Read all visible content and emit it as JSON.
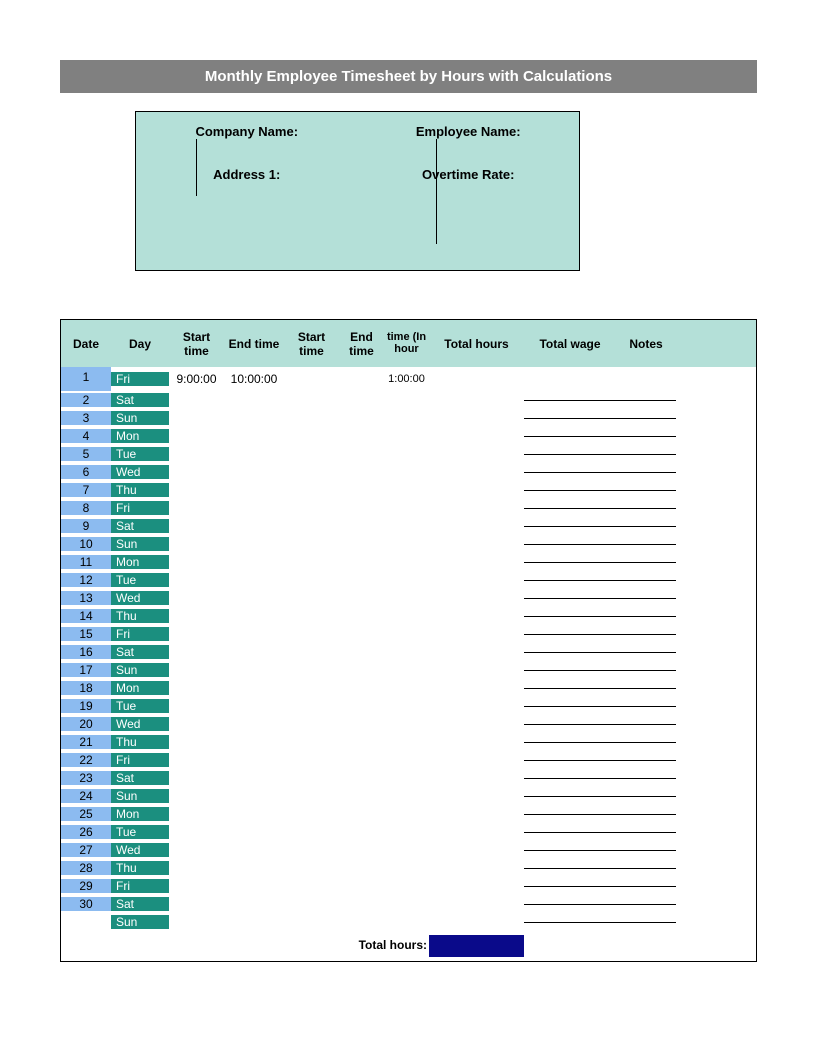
{
  "title": "Monthly Employee Timesheet by Hours with Calculations",
  "info": {
    "company_label": "Company Name:",
    "employee_label": "Employee Name:",
    "address_label": "Address 1:",
    "overtime_label": "Overtime Rate:"
  },
  "headers": {
    "date": "Date",
    "day": "Day",
    "start1": "Start time",
    "end1": "End time",
    "start2": "Start time",
    "end2": "End time",
    "tih": "time (In hour",
    "thours": "Total hours",
    "twage": "Total wage",
    "notes": "Notes"
  },
  "rows": [
    {
      "n": "1",
      "d": "Fri",
      "s": "9:00:00",
      "e": "10:00:00",
      "t": "1:00:00"
    },
    {
      "n": "2",
      "d": "Sat"
    },
    {
      "n": "3",
      "d": "Sun"
    },
    {
      "n": "4",
      "d": "Mon"
    },
    {
      "n": "5",
      "d": "Tue"
    },
    {
      "n": "6",
      "d": "Wed"
    },
    {
      "n": "7",
      "d": "Thu"
    },
    {
      "n": "8",
      "d": "Fri"
    },
    {
      "n": "9",
      "d": "Sat"
    },
    {
      "n": "10",
      "d": "Sun"
    },
    {
      "n": "11",
      "d": "Mon"
    },
    {
      "n": "12",
      "d": "Tue"
    },
    {
      "n": "13",
      "d": "Wed"
    },
    {
      "n": "14",
      "d": "Thu"
    },
    {
      "n": "15",
      "d": "Fri"
    },
    {
      "n": "16",
      "d": "Sat"
    },
    {
      "n": "17",
      "d": "Sun"
    },
    {
      "n": "18",
      "d": "Mon"
    },
    {
      "n": "19",
      "d": "Tue"
    },
    {
      "n": "20",
      "d": "Wed"
    },
    {
      "n": "21",
      "d": "Thu"
    },
    {
      "n": "22",
      "d": "Fri"
    },
    {
      "n": "23",
      "d": "Sat"
    },
    {
      "n": "24",
      "d": "Sun"
    },
    {
      "n": "25",
      "d": "Mon"
    },
    {
      "n": "26",
      "d": "Tue"
    },
    {
      "n": "27",
      "d": "Wed"
    },
    {
      "n": "28",
      "d": "Thu"
    },
    {
      "n": "29",
      "d": "Fri"
    },
    {
      "n": "30",
      "d": "Sat"
    },
    {
      "n": "",
      "d": "Sun"
    }
  ],
  "total_label": "Total hours:"
}
